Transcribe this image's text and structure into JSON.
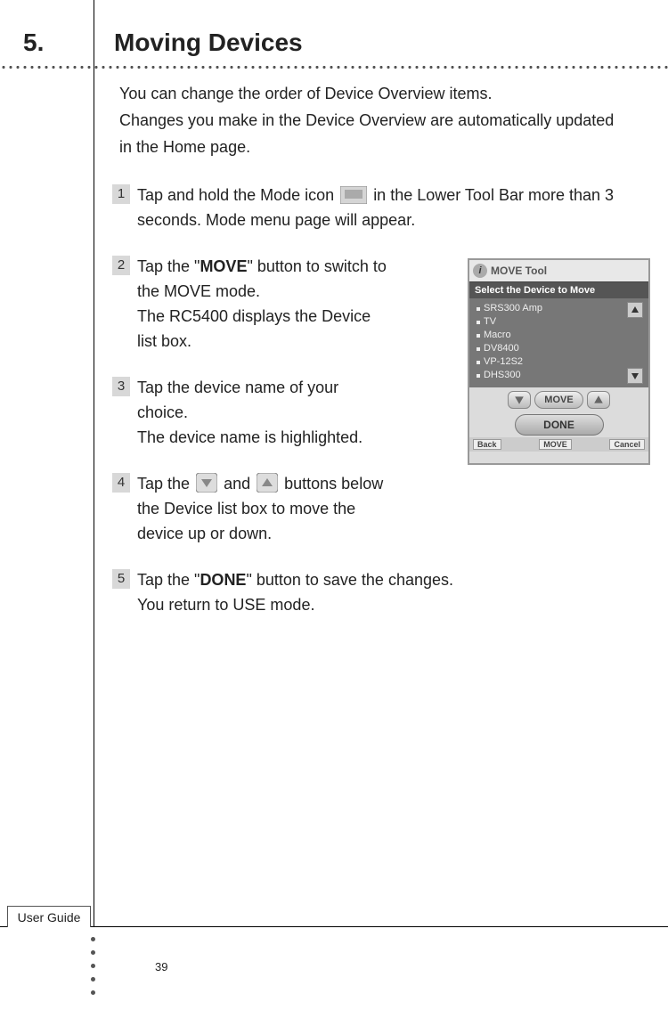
{
  "section": {
    "number": "5.",
    "title": "Moving Devices"
  },
  "intro": {
    "p1": "You can change the order of Device Overview items.",
    "p2": "Changes you make in the Device Overview are automatically updated in the Home page."
  },
  "steps": {
    "s1": {
      "num": "1",
      "before": "Tap and hold the Mode icon ",
      "after": " in the Lower Tool Bar more than 3 seconds. Mode menu page will appear."
    },
    "s2": {
      "num": "2",
      "a": "Tap the \"",
      "bold": "MOVE",
      "b": "\" button to switch to the MOVE mode.",
      "c": "The RC5400 displays the Device list box."
    },
    "s3": {
      "num": "3",
      "a": "Tap the device name of your choice.",
      "b": "The device name is highlighted."
    },
    "s4": {
      "num": "4",
      "a": "Tap the ",
      "b": " and ",
      "c": " buttons below the Device list box to move the device up or down."
    },
    "s5": {
      "num": "5",
      "a": "Tap the \"",
      "bold": "DONE",
      "b": "\" button to save the changes.",
      "c": "You return to USE mode."
    }
  },
  "screenshot": {
    "toolTitle": "MOVE Tool",
    "header": "Select the Device to Move",
    "devices": [
      "SRS300 Amp",
      "TV",
      "Macro",
      "DV8400",
      "VP-12S2",
      "DHS300"
    ],
    "moveBtn": "MOVE",
    "doneBtn": "DONE",
    "footer": {
      "back": "Back",
      "mid": "MOVE",
      "cancel": "Cancel"
    }
  },
  "footer": {
    "guide": "User Guide",
    "page": "39"
  }
}
